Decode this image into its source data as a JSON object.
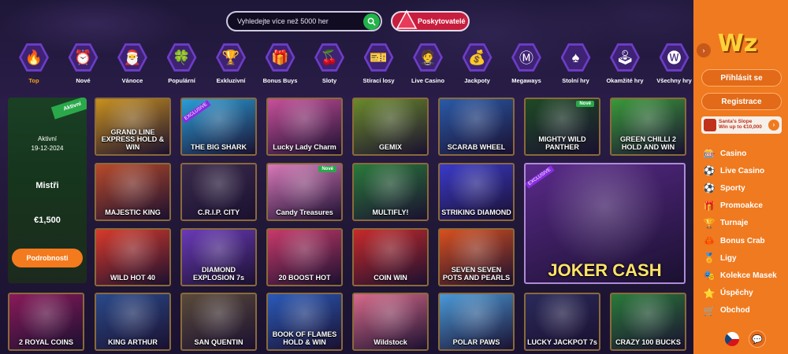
{
  "search": {
    "placeholder": "Vyhledejte více než 5000 her"
  },
  "providers": {
    "label": "Poskytovatelé"
  },
  "categories": [
    {
      "label": "Top",
      "icon": "fire-icon",
      "glyph": "🔥",
      "active": true
    },
    {
      "label": "Nové",
      "icon": "alarm-clock-icon",
      "glyph": "⏰"
    },
    {
      "label": "Vánoce",
      "icon": "santa-hat-icon",
      "glyph": "🎅"
    },
    {
      "label": "Populární",
      "icon": "clover-icon",
      "glyph": "🍀"
    },
    {
      "label": "Exkluzivní",
      "icon": "trophy-icon",
      "glyph": "🏆"
    },
    {
      "label": "Bonus Buys",
      "icon": "gift-icon",
      "glyph": "🎁"
    },
    {
      "label": "Sloty",
      "icon": "cherry-icon",
      "glyph": "🍒"
    },
    {
      "label": "Stírací losy",
      "icon": "scratch-ticket-icon",
      "glyph": "🎫"
    },
    {
      "label": "Live Casino",
      "icon": "dealer-icon",
      "glyph": "🤵"
    },
    {
      "label": "Jackpoty",
      "icon": "money-bag-icon",
      "glyph": "💰"
    },
    {
      "label": "Megaways",
      "icon": "m-letter-icon",
      "glyph": "Ⓜ"
    },
    {
      "label": "Stolní hry",
      "icon": "card-spade-icon",
      "glyph": "♠"
    },
    {
      "label": "Okamžité hry",
      "icon": "joystick-icon",
      "glyph": "🕹"
    },
    {
      "label": "Všechny hry",
      "icon": "all-games-icon",
      "glyph": "🅦"
    }
  ],
  "promo": {
    "ribbon": "Aktivní",
    "status": "Aktivní",
    "date": "19-12-2024",
    "title": "Mistři",
    "amount": "€1,500",
    "button": "Podrobnosti"
  },
  "games": [
    {
      "name": "GRAND LINE EXPRESS HOLD & WIN",
      "color": "#c8901e"
    },
    {
      "name": "THE BIG SHARK",
      "color": "#2a9ed8",
      "excl": true
    },
    {
      "name": "Lucky Lady Charm",
      "color": "#c8509a"
    },
    {
      "name": "GEMIX",
      "color": "#6a8a2a"
    },
    {
      "name": "SCARAB WHEEL",
      "color": "#2a5aa8"
    },
    {
      "name": "MIGHTY WILD PANTHER",
      "color": "#1e4a24",
      "tag": "Nové"
    },
    {
      "name": "GREEN CHILLI 2 HOLD AND WIN",
      "color": "#3a9a3a"
    },
    {
      "name": "MAJESTIC KING",
      "color": "#b84a2a"
    },
    {
      "name": "C.R.I.P. CITY",
      "color": "#3a2a4a"
    },
    {
      "name": "Candy Treasures",
      "color": "#d878b8",
      "tag": "Nové"
    },
    {
      "name": "MULTIFLY!",
      "color": "#2a7a3a"
    },
    {
      "name": "STRIKING DIAMOND",
      "color": "#3a3ac8"
    },
    {
      "name": "JOKER CASH",
      "color": "#5a2a8a",
      "big": true,
      "excl": true
    },
    {
      "name": "WILD HOT 40",
      "color": "#d83a2a"
    },
    {
      "name": "DIAMOND EXPLOSION 7s",
      "color": "#6a3ab8"
    },
    {
      "name": "20 BOOST HOT",
      "color": "#c83a6a"
    },
    {
      "name": "COIN WIN",
      "color": "#c82a2a"
    },
    {
      "name": "SEVEN SEVEN POTS AND PEARLS",
      "color": "#d8501e"
    },
    {
      "name": "2 ROYAL COINS",
      "color": "#8a1a5a"
    },
    {
      "name": "KING ARTHUR",
      "color": "#2a4a8a"
    },
    {
      "name": "SAN QUENTIN",
      "color": "#5a4a3a"
    },
    {
      "name": "BOOK OF FLAMES HOLD & WIN",
      "color": "#2a5ab8"
    },
    {
      "name": "Wildstock",
      "color": "#d86a8a"
    },
    {
      "name": "POLAR PAWS",
      "color": "#4a9ad8"
    },
    {
      "name": "LUCKY JACKPOT 7s",
      "color": "#2a2a5a"
    },
    {
      "name": "CRAZY 100 BUCKS",
      "color": "#2a7a3a"
    }
  ],
  "sidebar": {
    "logo": "Wz",
    "login": "Přihlásit se",
    "register": "Registrace",
    "promo_title": "Santa's Slope",
    "promo_sub": "Win up to €10,000",
    "items": [
      {
        "label": "Casino",
        "icon": "casino-chip-icon",
        "glyph": "🎰"
      },
      {
        "label": "Live Casino",
        "icon": "live-dealer-icon",
        "glyph": "⚽"
      },
      {
        "label": "Sporty",
        "icon": "football-icon",
        "glyph": "⚽"
      },
      {
        "label": "Promoakce",
        "icon": "gift-icon",
        "glyph": "🎁"
      },
      {
        "label": "Turnaje",
        "icon": "tournament-icon",
        "glyph": "🏆"
      },
      {
        "label": "Bonus Crab",
        "icon": "crab-icon",
        "glyph": "🦀"
      },
      {
        "label": "Ligy",
        "icon": "league-icon",
        "glyph": "🏅"
      },
      {
        "label": "Kolekce Masek",
        "icon": "mask-icon",
        "glyph": "🎭"
      },
      {
        "label": "Úspěchy",
        "icon": "achievement-icon",
        "glyph": "⭐"
      },
      {
        "label": "Obchod",
        "icon": "shop-icon",
        "glyph": "🛒"
      }
    ]
  }
}
